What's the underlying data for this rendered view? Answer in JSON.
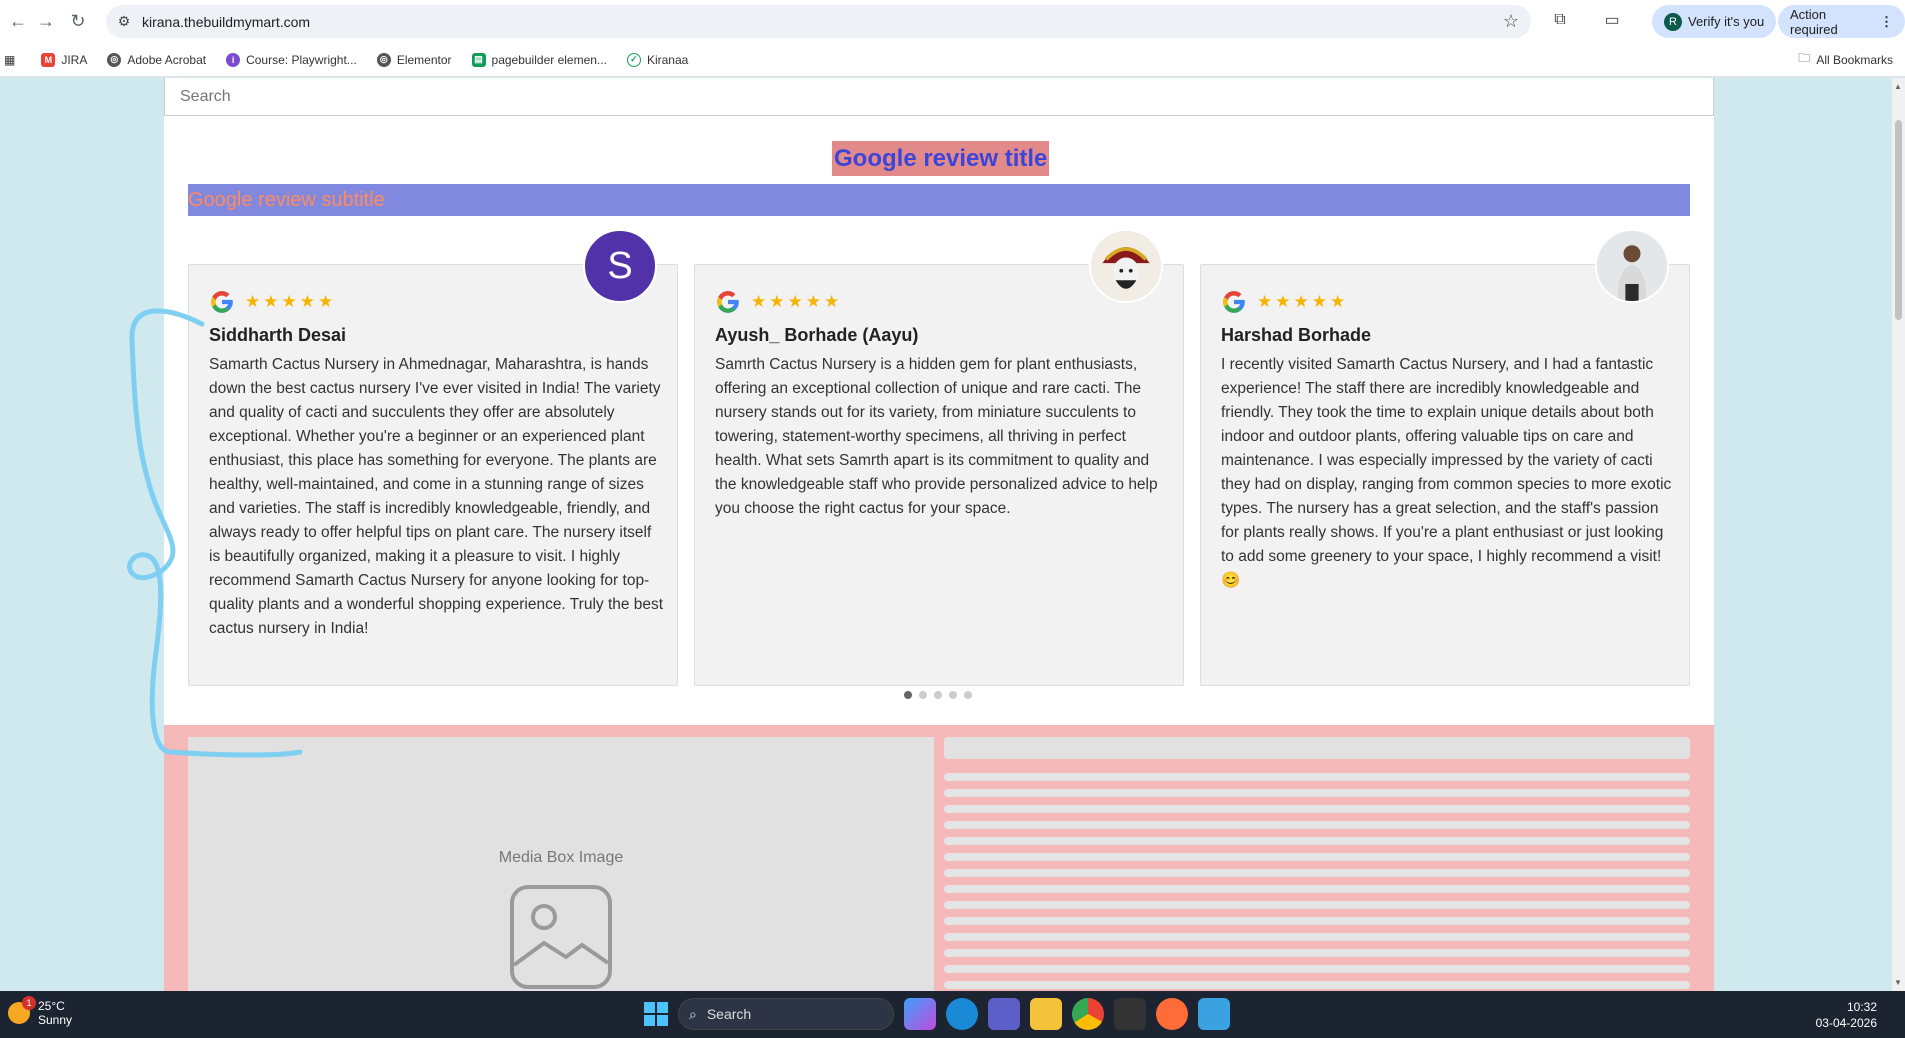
{
  "browser": {
    "url": "kirana.thebuildmymart.com",
    "verify_label": "Verify it's you",
    "verify_avatar": "R",
    "action_label": "Action required"
  },
  "bookmarks": {
    "items": [
      {
        "label": "JIRA",
        "icon": "gmail-icon",
        "color": "#ea4335"
      },
      {
        "label": "Adobe Acrobat",
        "icon": "globe-icon",
        "color": "#333333"
      },
      {
        "label": "Course: Playwright...",
        "icon": "course-icon",
        "color": "#7b4ccf"
      },
      {
        "label": "Elementor",
        "icon": "globe-icon",
        "color": "#333333"
      },
      {
        "label": "pagebuilder elemen...",
        "icon": "sheets-icon",
        "color": "#0f9d58"
      },
      {
        "label": "Kiranaa",
        "icon": "check-icon",
        "color": "#19a05a"
      }
    ],
    "all_label": "All Bookmarks"
  },
  "page": {
    "search_placeholder": "Search",
    "review_title": "Google review title",
    "review_subtitle": "Google review subtitle",
    "reviews": [
      {
        "name": "Siddharth Desai",
        "avatar_letter": "S",
        "stars": "★★★★★",
        "text": "Samarth Cactus Nursery in Ahmednagar, Maharashtra, is hands down the best cactus nursery I've ever visited in India! The variety and quality of cacti and succulents they offer are absolutely exceptional. Whether you're a beginner or an experienced plant enthusiast, this place has something for everyone. The plants are healthy, well-maintained, and come in a stunning range of sizes and varieties. The staff is incredibly knowledgeable, friendly, and always ready to offer helpful tips on plant care. The nursery itself is beautifully organized, making it a pleasure to visit. I highly recommend Samarth Cactus Nursery for anyone looking for top-quality plants and a wonderful shopping experience. Truly the best cactus nursery in India!"
      },
      {
        "name": "Ayush_ Borhade (Aayu)",
        "stars": "★★★★★",
        "text": "Samrth Cactus Nursery is a hidden gem for plant enthusiasts, offering an exceptional collection of unique and rare cacti. The nursery stands out for its variety, from miniature succulents to towering, statement-worthy specimens, all thriving in perfect health. What sets Samrth apart is its commitment to quality and the knowledgeable staff who provide personalized advice to help you choose the right cactus for your space."
      },
      {
        "name": "Harshad Borhade",
        "stars": "★★★★★",
        "text": "I recently visited Samarth Cactus Nursery, and I had a fantastic experience! The staff there are incredibly knowledgeable and friendly. They took the time to explain unique details about both indoor and outdoor plants, offering valuable tips on care and maintenance. I was especially impressed by the variety of cacti they had on display, ranging from common species to more exotic types. The nursery has a great selection, and the staff's passion for plants really shows. If you're a plant enthusiast or just looking to add some greenery to your space, I highly recommend a visit! 😊"
      }
    ],
    "media_label": "Media Box Image"
  },
  "taskbar": {
    "temperature": "25°C",
    "weather": "Sunny",
    "notification_count": "1",
    "search_label": "Search",
    "time": "10:32",
    "date": "03-04-2026"
  },
  "colors": {
    "page_bg": "#cfe9ee",
    "title_bg": "#e28a8a",
    "title_text": "#3d45d9",
    "subtitle_bg": "#8089dd",
    "subtitle_text": "#ff8a60",
    "section_bg": "#f6b9b9",
    "star": "#f4b400"
  }
}
